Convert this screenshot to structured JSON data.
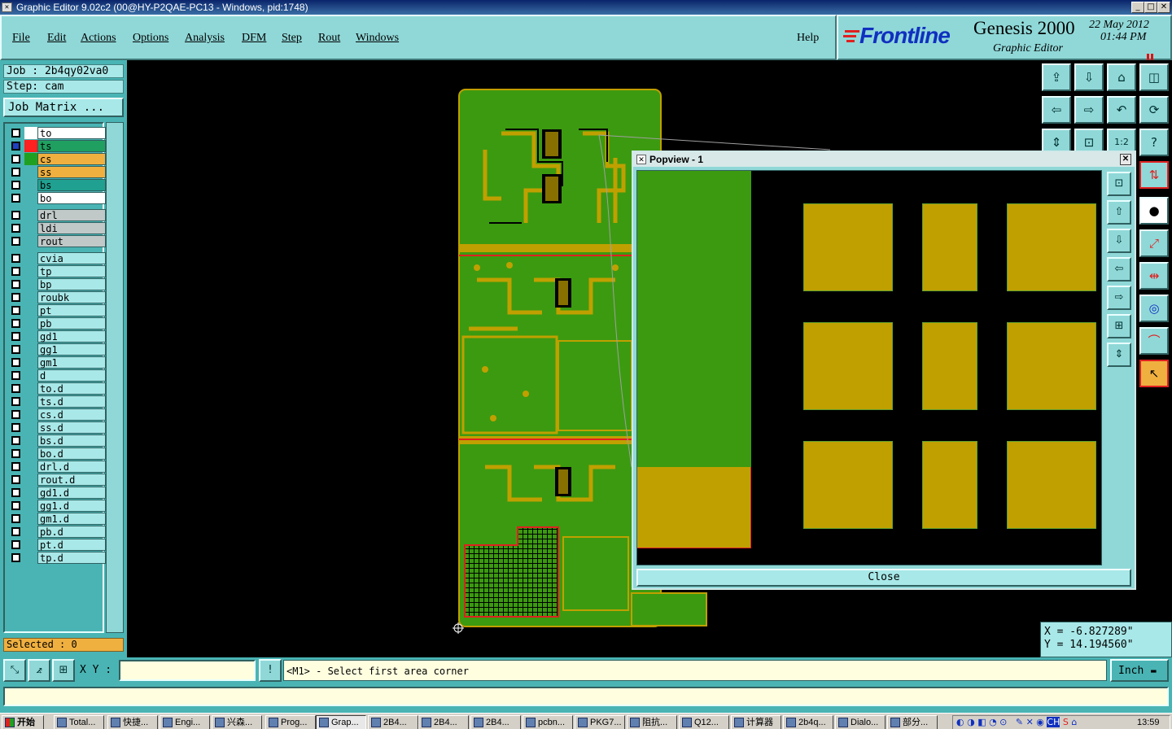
{
  "window": {
    "title": "Graphic Editor 9.02c2 (00@HY-P2QAE-PC13 - Windows, pid:1748)"
  },
  "menu": [
    "File",
    "Edit",
    "Actions",
    "Options",
    "Analysis",
    "DFM",
    "Step",
    "Rout",
    "Windows"
  ],
  "help": "Help",
  "logo": {
    "brand": "Frontline",
    "product": "Genesis 2000",
    "sub": "Graphic Editor",
    "date": "22 May 2012",
    "time": "01:44 PM"
  },
  "job": {
    "label": "Job : 2b4qy02va0",
    "step": "Step: cam",
    "matrix": "Job Matrix ..."
  },
  "layers_group1": [
    {
      "name": "to",
      "color": "#ffffff",
      "sel": "#ffffff",
      "mark": "✎"
    },
    {
      "name": "ts",
      "color": "#ff2020",
      "sel": "#2040c0",
      "mark": "⊞",
      "bg": "#20a060"
    },
    {
      "name": "cs",
      "color": "#20a020",
      "sel": "#ffffff",
      "mark": "✎",
      "bg": "#f0b040"
    },
    {
      "name": "ss",
      "color": "#4ab4b4",
      "sel": "#ffffff",
      "mark": "✎",
      "bg": "#f0b040"
    },
    {
      "name": "bs",
      "color": "#4ab4b4",
      "sel": "#ffffff",
      "mark": "",
      "bg": "#20a090"
    },
    {
      "name": "bo",
      "color": "#4ab4b4",
      "sel": "#ffffff",
      "mark": "",
      "bg": "#ffffff"
    }
  ],
  "layers_group2": [
    {
      "name": "drl",
      "mark": ""
    },
    {
      "name": "ldi",
      "mark": ""
    },
    {
      "name": "rout",
      "mark": ""
    }
  ],
  "layers_group3": [
    {
      "name": "cvia",
      "mark": ""
    },
    {
      "name": "tp",
      "mark": ""
    },
    {
      "name": "bp",
      "mark": ""
    },
    {
      "name": "roubk",
      "mark": ""
    },
    {
      "name": "pt",
      "mark": ""
    },
    {
      "name": "pb",
      "mark": ""
    },
    {
      "name": "gd1",
      "mark": "✎"
    },
    {
      "name": "gg1",
      "mark": ""
    },
    {
      "name": "gm1",
      "mark": ""
    },
    {
      "name": "d",
      "mark": ""
    },
    {
      "name": "to.d",
      "mark": "✎"
    },
    {
      "name": "ts.d",
      "mark": ""
    },
    {
      "name": "cs.d",
      "mark": "✎"
    },
    {
      "name": "ss.d",
      "mark": "✎"
    },
    {
      "name": "bs.d",
      "mark": ""
    },
    {
      "name": "bo.d",
      "mark": ""
    },
    {
      "name": "drl.d",
      "mark": ""
    },
    {
      "name": "rout.d",
      "mark": ""
    },
    {
      "name": "gd1.d",
      "mark": "✎"
    },
    {
      "name": "gg1.d",
      "mark": ""
    },
    {
      "name": "gm1.d",
      "mark": ""
    },
    {
      "name": "pb.d",
      "mark": ""
    },
    {
      "name": "pt.d",
      "mark": ""
    },
    {
      "name": "tp.d",
      "mark": ""
    }
  ],
  "selected": "Selected : 0",
  "popview": {
    "title": "Popview - 1",
    "close": "Close"
  },
  "coords": {
    "x": "X = -6.827289\"",
    "y": "Y = 14.194560\""
  },
  "xy_label": "X Y :",
  "xy_value": "",
  "prompt": "<M1> - Select first area corner",
  "units": "Inch",
  "taskbar": {
    "start": "开始",
    "tasks": [
      "Total...",
      "快捷...",
      "Engi...",
      "兴森...",
      "Prog...",
      "Grap...",
      "2B4...",
      "2B4...",
      "2B4...",
      "pcbn...",
      "PKG7...",
      "阻抗...",
      "Q12...",
      "计算器",
      "2b4q...",
      "Dialo...",
      "部分..."
    ],
    "clock": "13:59"
  },
  "colors": {
    "panel": "#4ab4b4",
    "board_green": "#3c9a10",
    "board_copper": "#c0a000"
  }
}
